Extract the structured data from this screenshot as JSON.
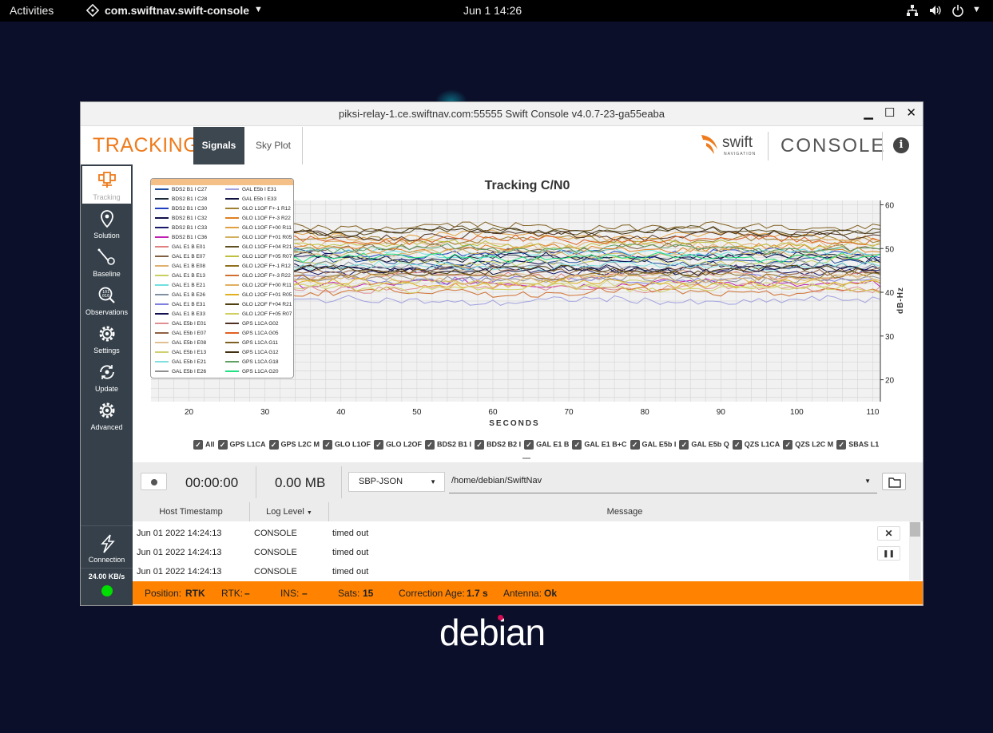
{
  "topbar": {
    "activities": "Activities",
    "app_name": "com.swiftnav.swift-console",
    "datetime": "Jun 1  14:26"
  },
  "window": {
    "title": "piksi-relay-1.ce.swiftnav.com:55555 Swift Console v4.0.7-23-ga55eaba"
  },
  "header": {
    "page_title": "TRACKING",
    "tabs": [
      "Signals",
      "Sky Plot"
    ],
    "brand": "swift",
    "brand_sub": "NAVIGATION",
    "console_label": "CONSOLE"
  },
  "sidebar": {
    "items": [
      "Tracking",
      "Solution",
      "Baseline",
      "Observations",
      "Settings",
      "Update",
      "Advanced"
    ],
    "connection": "Connection",
    "rate": "24.00 KB/s",
    "status_color": "#00dd00"
  },
  "chart_data": {
    "type": "line",
    "title": "Tracking C/N0",
    "xlabel": "SECONDS",
    "ylabel": "dB-Hz",
    "xlim": [
      15,
      111
    ],
    "ylim": [
      15,
      61
    ],
    "xticks": [
      20,
      30,
      40,
      50,
      60,
      70,
      80,
      90,
      100,
      110
    ],
    "yticks": [
      20,
      30,
      40,
      50,
      60
    ],
    "grid": true,
    "legend_position": "top-left",
    "series": [
      {
        "name": "BDS2 B1 I C27",
        "color": "#1f4e9c",
        "level": 47
      },
      {
        "name": "BDS2 B1 I C28",
        "color": "#1b2a3a",
        "level": 48
      },
      {
        "name": "BDS2 B1 I C30",
        "color": "#2040c0",
        "level": 49
      },
      {
        "name": "BDS2 B1 I C32",
        "color": "#10104a",
        "level": 46
      },
      {
        "name": "BDS2 B1 I C33",
        "color": "#1a1a6a",
        "level": 45
      },
      {
        "name": "BDS2 B1 I C36",
        "color": "#c020b0",
        "level": 42
      },
      {
        "name": "GAL E1 B E01",
        "color": "#e08080",
        "level": 44
      },
      {
        "name": "GAL E1 B E07",
        "color": "#806040",
        "level": 50
      },
      {
        "name": "GAL E1 B E08",
        "color": "#e0b070",
        "level": 51
      },
      {
        "name": "GAL E1 B E13",
        "color": "#c8d060",
        "level": 47
      },
      {
        "name": "GAL E1 B E21",
        "color": "#70e0e0",
        "level": 49
      },
      {
        "name": "GAL E1 B E26",
        "color": "#8090a0",
        "level": 46
      },
      {
        "name": "GAL E1 B E31",
        "color": "#8080e0",
        "level": 43
      },
      {
        "name": "GAL E1 B E33",
        "color": "#101050",
        "level": 48
      },
      {
        "name": "GAL E5b I E01",
        "color": "#e09090",
        "level": 41
      },
      {
        "name": "GAL E5b I E07",
        "color": "#906040",
        "level": 45
      },
      {
        "name": "GAL E5b I E08",
        "color": "#e0c090",
        "level": 44
      },
      {
        "name": "GAL E5b I E13",
        "color": "#d0d070",
        "level": 42
      },
      {
        "name": "GAL E5b I E21",
        "color": "#80e0e0",
        "level": 46
      },
      {
        "name": "GAL E5b I E26",
        "color": "#909090",
        "level": 43
      },
      {
        "name": "GAL E5b I E31",
        "color": "#a0a0e0",
        "level": 38
      },
      {
        "name": "GAL E5b I E33",
        "color": "#101040",
        "level": 45
      },
      {
        "name": "GLO L1OF F+-1 R12",
        "color": "#a08030",
        "level": 52
      },
      {
        "name": "GLO L1OF F+-3 R22",
        "color": "#e08020",
        "level": 50
      },
      {
        "name": "GLO L1OF F+00 R11",
        "color": "#e0a040",
        "level": 53
      },
      {
        "name": "GLO L1OF F+01 R05",
        "color": "#d0b060",
        "level": 49
      },
      {
        "name": "GLO L1OF F+04 R21",
        "color": "#605020",
        "level": 54
      },
      {
        "name": "GLO L1OF F+05 R07",
        "color": "#c0c040",
        "level": 51
      },
      {
        "name": "GLO L2OF F+-1 R12",
        "color": "#907020",
        "level": 44
      },
      {
        "name": "GLO L2OF F+-3 R22",
        "color": "#d07030",
        "level": 40
      },
      {
        "name": "GLO L2OF F+00 R11",
        "color": "#e0b060",
        "level": 43
      },
      {
        "name": "GLO L2OF F+01 R05",
        "color": "#e0b020",
        "level": 42
      },
      {
        "name": "GLO L2OF F+04 R21",
        "color": "#504010",
        "level": 45
      },
      {
        "name": "GLO L2OF F+05 R07",
        "color": "#d0d060",
        "level": 41
      },
      {
        "name": "GPS L1CA G02",
        "color": "#503020",
        "level": 53
      },
      {
        "name": "GPS L1CA G05",
        "color": "#e06020",
        "level": 52
      },
      {
        "name": "GPS L1CA G11",
        "color": "#806020",
        "level": 55
      },
      {
        "name": "GPS L1CA G12",
        "color": "#403010",
        "level": 54
      },
      {
        "name": "GPS L1CA G18",
        "color": "#60a060",
        "level": 50
      },
      {
        "name": "GPS L1CA G20",
        "color": "#20e080",
        "level": 48
      }
    ]
  },
  "filters": [
    "All",
    "GPS L1CA",
    "GPS L2C M",
    "GLO L1OF",
    "GLO L2OF",
    "BDS2 B1 I",
    "BDS2 B2 I",
    "GAL E1 B",
    "GAL E1 B+C",
    "GAL E5b I",
    "GAL E5b Q",
    "QZS L1CA",
    "QZS L2C M",
    "SBAS L1"
  ],
  "recorder": {
    "elapsed": "00:00:00",
    "size": "0.00 MB",
    "format": "SBP-JSON",
    "path": "/home/debian/SwiftNav"
  },
  "log": {
    "headers": [
      "Host Timestamp",
      "Log Level",
      "Message"
    ],
    "rows": [
      {
        "time": "Jun 01 2022 14:24:13",
        "level": "CONSOLE",
        "msg": "timed out"
      },
      {
        "time": "Jun 01 2022 14:24:13",
        "level": "CONSOLE",
        "msg": "timed out"
      },
      {
        "time": "Jun 01 2022 14:24:13",
        "level": "CONSOLE",
        "msg": "timed out"
      }
    ]
  },
  "status": {
    "position_label": "Position:",
    "position": "RTK",
    "rtk_label": "RTK:",
    "rtk": "–",
    "ins_label": "INS:",
    "ins": "–",
    "sats_label": "Sats:",
    "sats": "15",
    "corr_label": "Correction Age:",
    "corr": "1.7 s",
    "ant_label": "Antenna:",
    "ant": "Ok"
  },
  "desktop": {
    "logo_text": "debian"
  }
}
